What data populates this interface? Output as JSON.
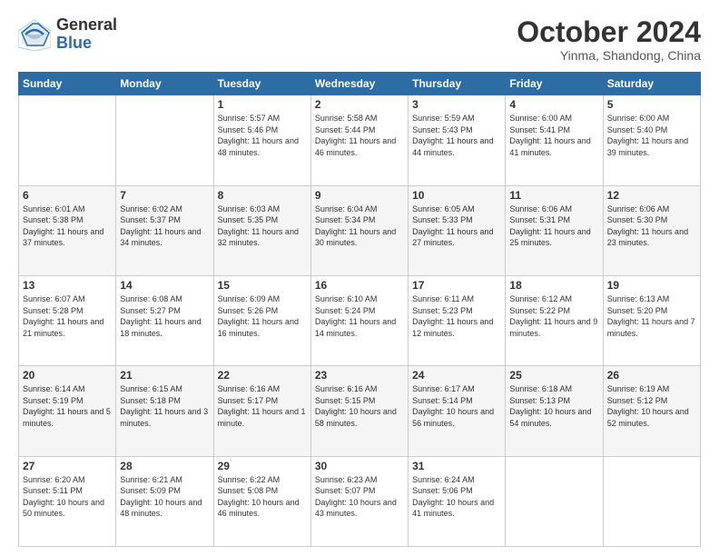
{
  "logo": {
    "general": "General",
    "blue": "Blue"
  },
  "title": "October 2024",
  "subtitle": "Yinma, Shandong, China",
  "days_header": [
    "Sunday",
    "Monday",
    "Tuesday",
    "Wednesday",
    "Thursday",
    "Friday",
    "Saturday"
  ],
  "weeks": [
    [
      {
        "day": "",
        "info": ""
      },
      {
        "day": "",
        "info": ""
      },
      {
        "day": "1",
        "info": "Sunrise: 5:57 AM\nSunset: 5:46 PM\nDaylight: 11 hours and 48 minutes."
      },
      {
        "day": "2",
        "info": "Sunrise: 5:58 AM\nSunset: 5:44 PM\nDaylight: 11 hours and 46 minutes."
      },
      {
        "day": "3",
        "info": "Sunrise: 5:59 AM\nSunset: 5:43 PM\nDaylight: 11 hours and 44 minutes."
      },
      {
        "day": "4",
        "info": "Sunrise: 6:00 AM\nSunset: 5:41 PM\nDaylight: 11 hours and 41 minutes."
      },
      {
        "day": "5",
        "info": "Sunrise: 6:00 AM\nSunset: 5:40 PM\nDaylight: 11 hours and 39 minutes."
      }
    ],
    [
      {
        "day": "6",
        "info": "Sunrise: 6:01 AM\nSunset: 5:38 PM\nDaylight: 11 hours and 37 minutes."
      },
      {
        "day": "7",
        "info": "Sunrise: 6:02 AM\nSunset: 5:37 PM\nDaylight: 11 hours and 34 minutes."
      },
      {
        "day": "8",
        "info": "Sunrise: 6:03 AM\nSunset: 5:35 PM\nDaylight: 11 hours and 32 minutes."
      },
      {
        "day": "9",
        "info": "Sunrise: 6:04 AM\nSunset: 5:34 PM\nDaylight: 11 hours and 30 minutes."
      },
      {
        "day": "10",
        "info": "Sunrise: 6:05 AM\nSunset: 5:33 PM\nDaylight: 11 hours and 27 minutes."
      },
      {
        "day": "11",
        "info": "Sunrise: 6:06 AM\nSunset: 5:31 PM\nDaylight: 11 hours and 25 minutes."
      },
      {
        "day": "12",
        "info": "Sunrise: 6:06 AM\nSunset: 5:30 PM\nDaylight: 11 hours and 23 minutes."
      }
    ],
    [
      {
        "day": "13",
        "info": "Sunrise: 6:07 AM\nSunset: 5:28 PM\nDaylight: 11 hours and 21 minutes."
      },
      {
        "day": "14",
        "info": "Sunrise: 6:08 AM\nSunset: 5:27 PM\nDaylight: 11 hours and 18 minutes."
      },
      {
        "day": "15",
        "info": "Sunrise: 6:09 AM\nSunset: 5:26 PM\nDaylight: 11 hours and 16 minutes."
      },
      {
        "day": "16",
        "info": "Sunrise: 6:10 AM\nSunset: 5:24 PM\nDaylight: 11 hours and 14 minutes."
      },
      {
        "day": "17",
        "info": "Sunrise: 6:11 AM\nSunset: 5:23 PM\nDaylight: 11 hours and 12 minutes."
      },
      {
        "day": "18",
        "info": "Sunrise: 6:12 AM\nSunset: 5:22 PM\nDaylight: 11 hours and 9 minutes."
      },
      {
        "day": "19",
        "info": "Sunrise: 6:13 AM\nSunset: 5:20 PM\nDaylight: 11 hours and 7 minutes."
      }
    ],
    [
      {
        "day": "20",
        "info": "Sunrise: 6:14 AM\nSunset: 5:19 PM\nDaylight: 11 hours and 5 minutes."
      },
      {
        "day": "21",
        "info": "Sunrise: 6:15 AM\nSunset: 5:18 PM\nDaylight: 11 hours and 3 minutes."
      },
      {
        "day": "22",
        "info": "Sunrise: 6:16 AM\nSunset: 5:17 PM\nDaylight: 11 hours and 1 minute."
      },
      {
        "day": "23",
        "info": "Sunrise: 6:16 AM\nSunset: 5:15 PM\nDaylight: 10 hours and 58 minutes."
      },
      {
        "day": "24",
        "info": "Sunrise: 6:17 AM\nSunset: 5:14 PM\nDaylight: 10 hours and 56 minutes."
      },
      {
        "day": "25",
        "info": "Sunrise: 6:18 AM\nSunset: 5:13 PM\nDaylight: 10 hours and 54 minutes."
      },
      {
        "day": "26",
        "info": "Sunrise: 6:19 AM\nSunset: 5:12 PM\nDaylight: 10 hours and 52 minutes."
      }
    ],
    [
      {
        "day": "27",
        "info": "Sunrise: 6:20 AM\nSunset: 5:11 PM\nDaylight: 10 hours and 50 minutes."
      },
      {
        "day": "28",
        "info": "Sunrise: 6:21 AM\nSunset: 5:09 PM\nDaylight: 10 hours and 48 minutes."
      },
      {
        "day": "29",
        "info": "Sunrise: 6:22 AM\nSunset: 5:08 PM\nDaylight: 10 hours and 46 minutes."
      },
      {
        "day": "30",
        "info": "Sunrise: 6:23 AM\nSunset: 5:07 PM\nDaylight: 10 hours and 43 minutes."
      },
      {
        "day": "31",
        "info": "Sunrise: 6:24 AM\nSunset: 5:06 PM\nDaylight: 10 hours and 41 minutes."
      },
      {
        "day": "",
        "info": ""
      },
      {
        "day": "",
        "info": ""
      }
    ]
  ]
}
